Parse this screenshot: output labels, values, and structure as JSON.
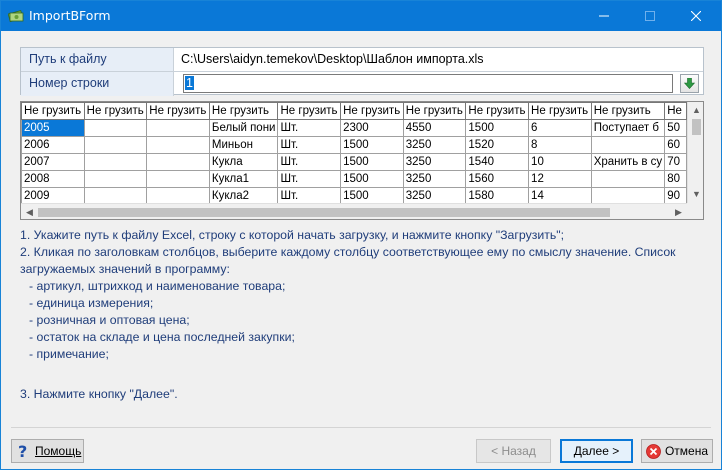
{
  "window": {
    "title": "ImportBForm",
    "icon": "money-icon",
    "controls": [
      "minimize-icon",
      "maximize-icon",
      "close-icon"
    ]
  },
  "file_path": {
    "label": "Путь к файлу",
    "value": "C:\\Users\\aidyn.temekov\\Desktop\\Шаблон импорта.xls"
  },
  "row_number": {
    "label": "Номер строки",
    "value": "1"
  },
  "grid": {
    "columns": [
      "Не грузить",
      "Не грузить",
      "Не грузить",
      "Не грузить",
      "Не грузить",
      "Не грузить",
      "Не грузить",
      "Не грузить",
      "Не грузить",
      "Не грузить",
      "Не"
    ],
    "rows": [
      [
        "2005",
        "",
        "",
        "Белый пони",
        "Шт.",
        "2300",
        "4550",
        "1500",
        "6",
        "Поступает б",
        "50"
      ],
      [
        "2006",
        "",
        "",
        "Миньон",
        "Шт.",
        "1500",
        "3250",
        "1520",
        "8",
        "",
        "60"
      ],
      [
        "2007",
        "",
        "",
        "Кукла",
        "Шт.",
        "1500",
        "3250",
        "1540",
        "10",
        "Хранить в су",
        "70"
      ],
      [
        "2008",
        "",
        "",
        "Кукла1",
        "Шт.",
        "1500",
        "3250",
        "1560",
        "12",
        "",
        "80"
      ],
      [
        "2009",
        "",
        "",
        "Кукла2",
        "Шт.",
        "1500",
        "3250",
        "1580",
        "14",
        "",
        "90"
      ]
    ]
  },
  "instructions": {
    "step1": "1. Укажите путь к файлу Excel, строку с которой начать загрузку, и нажмите кнопку \"Загрузить\";",
    "step2_line1": "2. Кликая по заголовкам столбцов, выберите каждому столбцу соответствующее ему по смыслу значение. Список",
    "step2_line2": "загружаемых значений в программу:",
    "items": [
      "- артикул, штрихкод и наименование товара;",
      "- единица измерения;",
      "- розничная и оптовая цена;",
      "- остаток на складе и цена последней закупки;",
      "- примечание;"
    ],
    "step3": "3. Нажмите кнопку \"Далее\"."
  },
  "buttons": {
    "help": "Помощь",
    "back": "< Назад",
    "next": "Далее >",
    "cancel": "Отмена"
  }
}
